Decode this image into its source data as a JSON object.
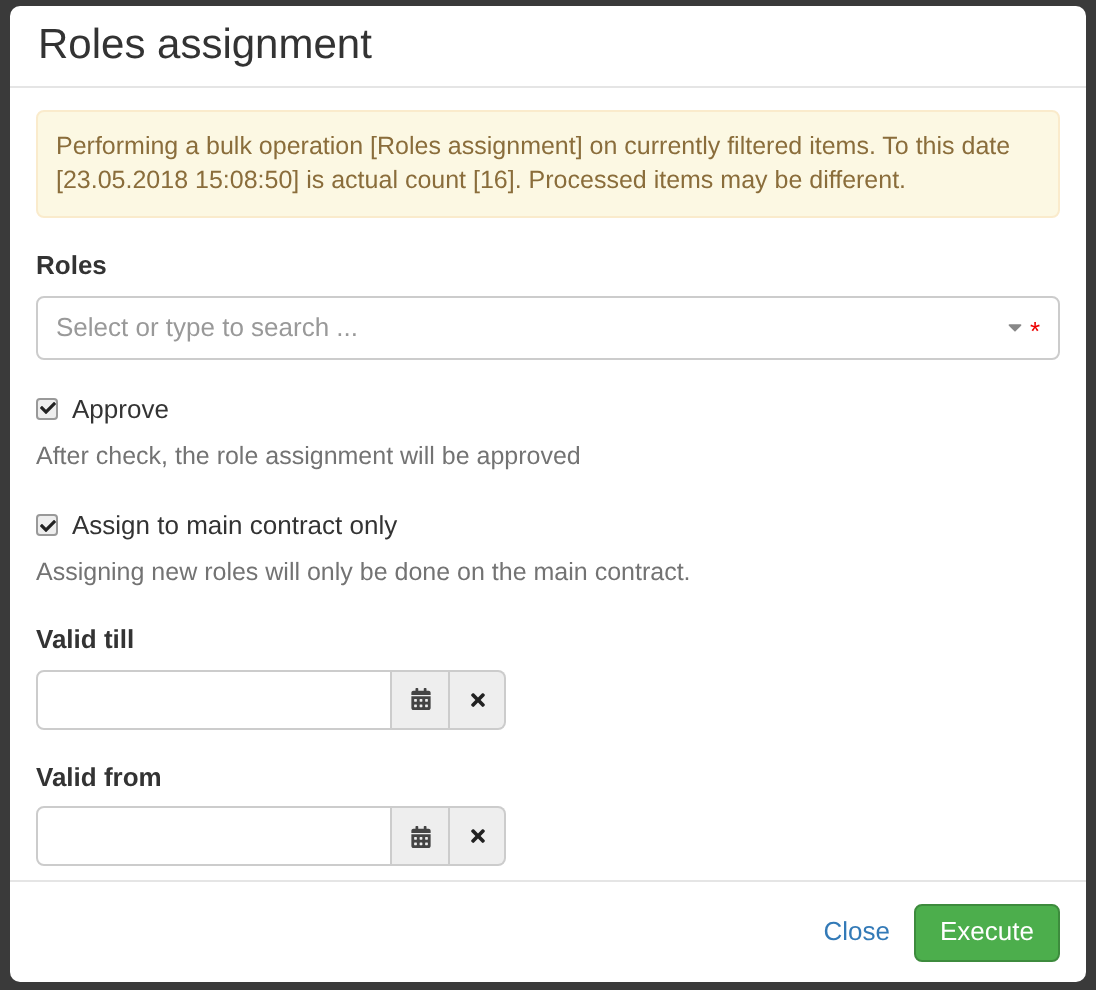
{
  "dialog": {
    "title": "Roles assignment"
  },
  "alert": "Performing a bulk operation [Roles assignment] on currently filtered items. To this date [23.05.2018 15:08:50] is actual count [16]. Processed items may be different.",
  "roles": {
    "label": "Roles",
    "placeholder": "Select or type to search ...",
    "required": true,
    "required_mark": "*"
  },
  "options": [
    {
      "label": "Approve",
      "checked": true,
      "help": "After check, the role assignment will be approved"
    },
    {
      "label": "Assign to main contract only",
      "checked": true,
      "help": "Assigning new roles will only be done on the main contract."
    }
  ],
  "dates": [
    {
      "label": "Valid till"
    },
    {
      "label": "Valid from"
    }
  ],
  "buttons": [
    {
      "label": "Close",
      "kind": "link"
    },
    {
      "label": "Execute",
      "kind": "primary"
    }
  ]
}
